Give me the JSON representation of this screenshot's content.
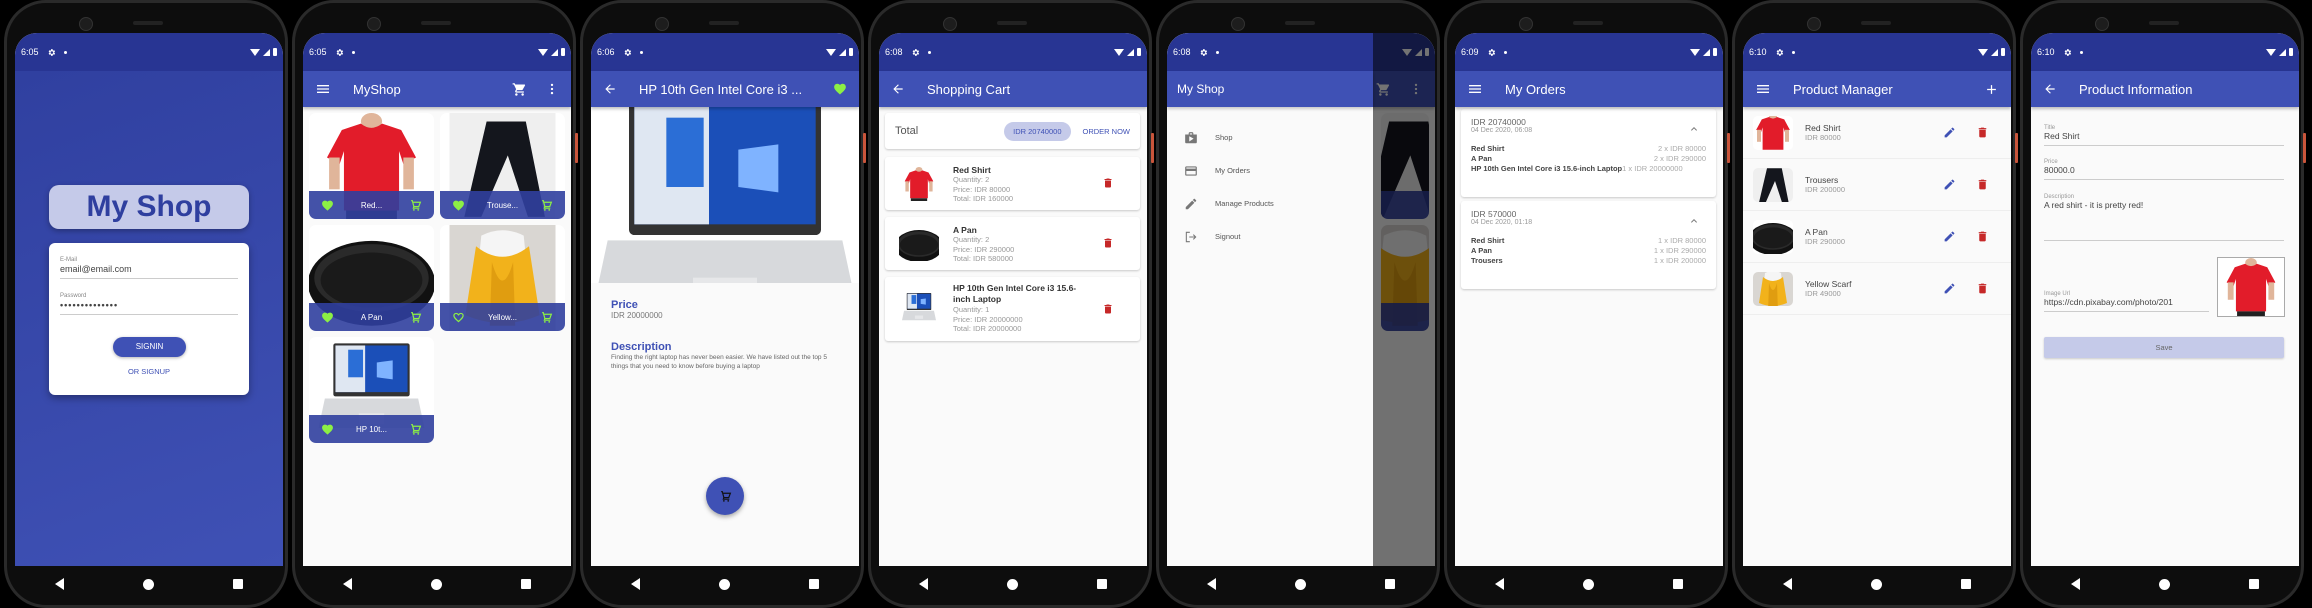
{
  "theme": {
    "primary": "#3f51b5",
    "primary_dark": "#283593",
    "accent_green": "#8cf045",
    "danger": "#c62828",
    "pill_bg": "#c5cae9"
  },
  "screens": {
    "login": {
      "status_time": "6:05",
      "brand": "My Shop",
      "email_label": "E-Mail",
      "email_value": "email@email.com",
      "password_label": "Password",
      "password_value": "••••••••••••••",
      "signin_label": "SIGNIN",
      "signup_label": "OR SIGNUP"
    },
    "shop": {
      "status_time": "6:05",
      "title": "MyShop",
      "products": [
        {
          "label": "Red...",
          "favorite": true,
          "image": "red-shirt"
        },
        {
          "label": "Trouse...",
          "favorite": true,
          "image": "trousers"
        },
        {
          "label": "A Pan",
          "favorite": true,
          "image": "pan"
        },
        {
          "label": "Yellow...",
          "favorite": false,
          "image": "yellow-scarf"
        },
        {
          "label": "HP 10t...",
          "favorite": true,
          "image": "laptop"
        }
      ]
    },
    "detail": {
      "status_time": "6:06",
      "title": "HP 10th Gen Intel Core i3 ...",
      "price_heading": "Price",
      "price_value": "IDR 20000000",
      "description_heading": "Description",
      "description_value": "Finding the right laptop has never been easier. We have listed out the top 5 things that you need to know before buying a laptop"
    },
    "cart": {
      "status_time": "6:08",
      "title": "Shopping Cart",
      "total_label": "Total",
      "total_value": "IDR 20740000",
      "order_now": "ORDER NOW",
      "items": [
        {
          "name": "Red Shirt",
          "quantity": "Quantity: 2",
          "price": "Price: IDR 80000",
          "total": "Total: IDR 160000"
        },
        {
          "name": "A Pan",
          "quantity": "Quantity: 2",
          "price": "Price: IDR 290000",
          "total": "Total: IDR 580000"
        },
        {
          "name": "HP 10th Gen Intel Core i3 15.6-inch Laptop",
          "quantity": "Quantity: 1",
          "price": "Price: IDR 20000000",
          "total": "Total: IDR 20000000"
        }
      ]
    },
    "drawer": {
      "status_time": "6:08",
      "title": "My Shop",
      "items": [
        {
          "label": "Shop",
          "icon": "shop-icon"
        },
        {
          "label": "My Orders",
          "icon": "credit-card-icon"
        },
        {
          "label": "Manage Products",
          "icon": "pencil-icon"
        },
        {
          "label": "Signout",
          "icon": "exit-icon"
        }
      ]
    },
    "orders": {
      "status_time": "6:09",
      "title": "My Orders",
      "orders": [
        {
          "total": "IDR 20740000",
          "date": "04 Dec 2020, 06:08",
          "lines": [
            {
              "name": "Red Shirt",
              "qty": "2 x IDR 80000"
            },
            {
              "name": "A Pan",
              "qty": "2 x IDR 290000"
            },
            {
              "name": "HP 10th Gen Intel Core i3 15.6-inch Laptop",
              "qty": "1 x IDR 20000000"
            }
          ]
        },
        {
          "total": "IDR 570000",
          "date": "04 Dec 2020, 01:18",
          "lines": [
            {
              "name": "Red Shirt",
              "qty": "1 x IDR 80000"
            },
            {
              "name": "A Pan",
              "qty": "1 x IDR 290000"
            },
            {
              "name": "Trousers",
              "qty": "1 x IDR 200000"
            }
          ]
        }
      ]
    },
    "manager": {
      "status_time": "6:10",
      "title": "Product Manager",
      "products": [
        {
          "name": "Red Shirt",
          "price": "IDR 80000",
          "image": "red-shirt"
        },
        {
          "name": "Trousers",
          "price": "IDR 200000",
          "image": "trousers"
        },
        {
          "name": "A Pan",
          "price": "IDR 290000",
          "image": "pan"
        },
        {
          "name": "Yellow Scarf",
          "price": "IDR 49000",
          "image": "yellow-scarf"
        }
      ]
    },
    "edit": {
      "status_time": "6:10",
      "title": "Product Information",
      "title_label": "Title",
      "title_value": "Red Shirt",
      "price_label": "Price",
      "price_value": "80000.0",
      "description_label": "Description",
      "description_value": "A red shirt - it is pretty red!",
      "image_label": "Image Url",
      "image_value": "https://cdn.pixabay.com/photo/201",
      "save_label": "Save"
    }
  }
}
